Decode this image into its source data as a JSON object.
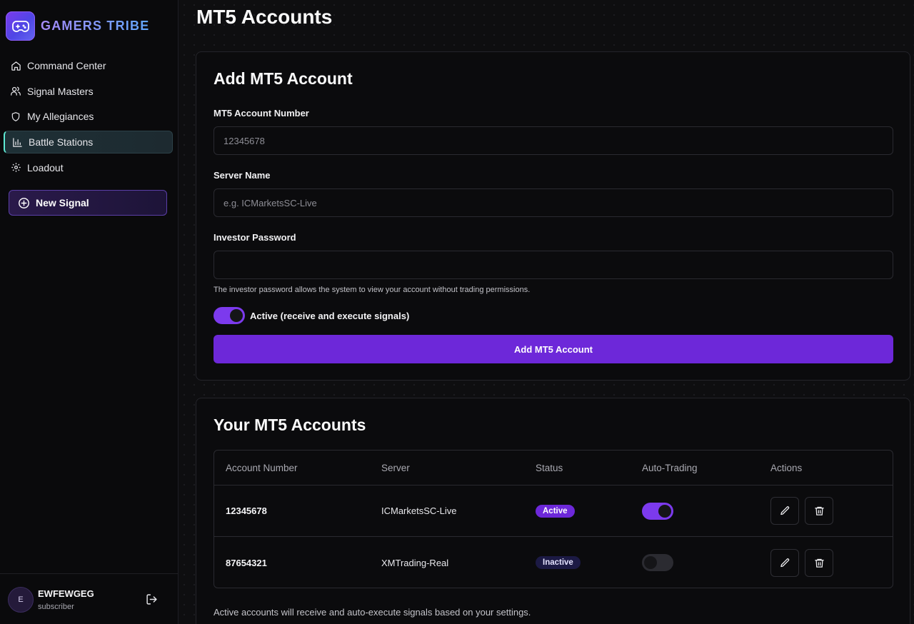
{
  "brand": {
    "name": "GAMERS TRIBE",
    "logo_icon": "gamepad-icon"
  },
  "sidebar": {
    "items": [
      {
        "label": "Command Center",
        "icon": "home-icon",
        "active": false
      },
      {
        "label": "Signal Masters",
        "icon": "users-icon",
        "active": false
      },
      {
        "label": "My Allegiances",
        "icon": "shield-icon",
        "active": false
      },
      {
        "label": "Battle Stations",
        "icon": "bar-chart-icon",
        "active": true
      },
      {
        "label": "Loadout",
        "icon": "gear-icon",
        "active": false
      }
    ],
    "new_signal_label": "New Signal"
  },
  "user": {
    "initial": "E",
    "name": "EWFEWGEG",
    "role": "subscriber"
  },
  "page": {
    "title": "MT5 Accounts"
  },
  "add_form": {
    "title": "Add MT5 Account",
    "account_number_label": "MT5 Account Number",
    "account_number_placeholder": "12345678",
    "server_label": "Server Name",
    "server_placeholder": "e.g. ICMarketsSC-Live",
    "password_label": "Investor Password",
    "password_hint": "The investor password allows the system to view your account without trading permissions.",
    "active_label": "Active (receive and execute signals)",
    "active_on": true,
    "submit_label": "Add MT5 Account"
  },
  "accounts": {
    "title": "Your MT5 Accounts",
    "columns": [
      "Account Number",
      "Server",
      "Status",
      "Auto-Trading",
      "Actions"
    ],
    "rows": [
      {
        "account": "12345678",
        "server": "ICMarketsSC-Live",
        "status": "Active",
        "auto_trading": true
      },
      {
        "account": "87654321",
        "server": "XMTrading-Real",
        "status": "Inactive",
        "auto_trading": false
      }
    ],
    "footnote": "Active accounts will receive and auto-execute signals based on your settings."
  },
  "colors": {
    "accent": "#6d28d9",
    "active_nav": "#1e3036",
    "background": "#0e0e10"
  }
}
